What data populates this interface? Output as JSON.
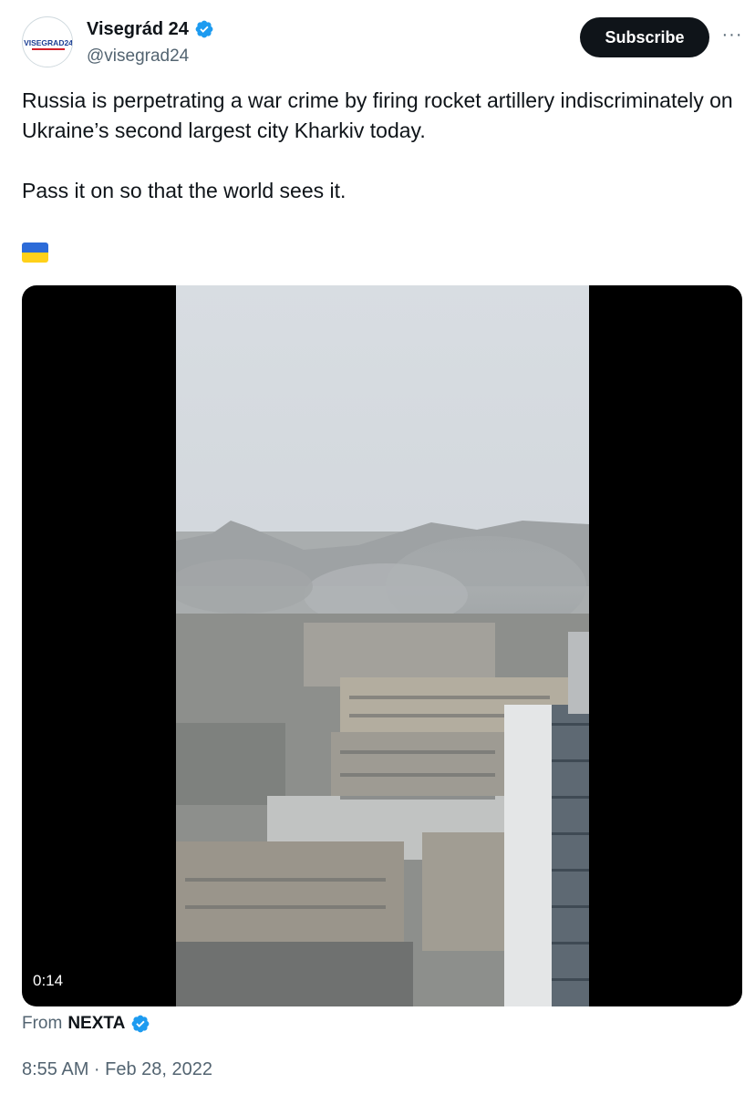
{
  "author": {
    "name": "Visegrád 24",
    "handle": "@visegrad24",
    "avatar_text": "VISEGRAD24"
  },
  "actions": {
    "subscribe_label": "Subscribe",
    "more_label": "···"
  },
  "tweet": {
    "line1": "Russia is perpetrating a war crime by firing rocket artillery indiscriminately on Ukraine’s second largest city Kharkiv today.",
    "line2": "Pass it on so that the world sees it."
  },
  "video": {
    "duration": "0:14"
  },
  "source": {
    "prefix": "From",
    "name": "NEXTA"
  },
  "timestamp": "8:55 AM · Feb 28, 2022",
  "colors": {
    "verified": "#1d9bf0",
    "flag_blue": "#2c6bd8",
    "flag_yellow": "#ffd11a",
    "avatar_blue": "#1c3f94",
    "avatar_red": "#d4202a"
  }
}
